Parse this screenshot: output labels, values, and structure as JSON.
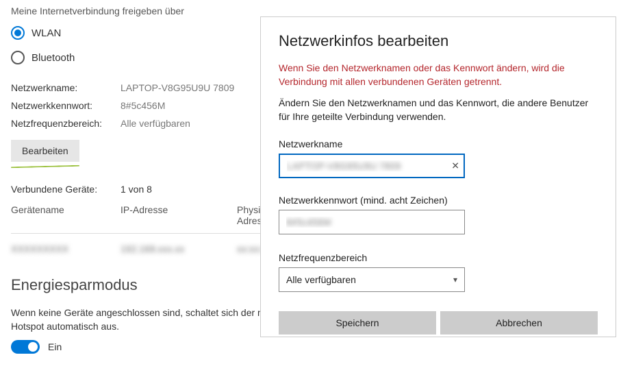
{
  "share": {
    "heading": "Meine Internetverbindung freigeben über",
    "options": {
      "wlan": "WLAN",
      "bluetooth": "Bluetooth"
    }
  },
  "network": {
    "name_label": "Netzwerkname:",
    "name_value": "LAPTOP-V8G95U9U 7809",
    "password_label": "Netzwerkkennwort:",
    "password_value": "8#5c456M",
    "band_label": "Netzfrequenzbereich:",
    "band_value": "Alle verfügbaren",
    "edit_label": "Bearbeiten"
  },
  "devices": {
    "connected_label": "Verbundene Geräte:",
    "connected_value": "1 von 8",
    "col_name": "Gerätename",
    "col_ip": "IP-Adresse",
    "col_mac": "Physische Adresse (MAC)",
    "row1": {
      "name": "XXXXXXXXX",
      "ip": "192.168.xxx.xx",
      "mac": "xx:xx:xx:xx:xx"
    }
  },
  "energy": {
    "title": "Energiesparmodus",
    "desc": "Wenn keine Geräte angeschlossen sind, schaltet sich der mobile Hotspot automatisch aus.",
    "toggle_label": "Ein"
  },
  "dialog": {
    "title": "Netzwerkinfos bearbeiten",
    "warning": "Wenn Sie den Netzwerknamen oder das Kennwort ändern, wird die Verbindung mit allen verbundenen Geräten getrennt.",
    "desc": "Ändern Sie den Netzwerknamen und das Kennwort, die andere Benutzer für Ihre geteilte Verbindung verwenden.",
    "name_label": "Netzwerkname",
    "name_value": "LAPTOP-V8G95U9U 7809",
    "password_label": "Netzwerkkennwort (mind. acht Zeichen)",
    "password_value": "8#5c456M",
    "band_label": "Netzfrequenzbereich",
    "band_value": "Alle verfügbaren",
    "save_label": "Speichern",
    "cancel_label": "Abbrechen"
  }
}
